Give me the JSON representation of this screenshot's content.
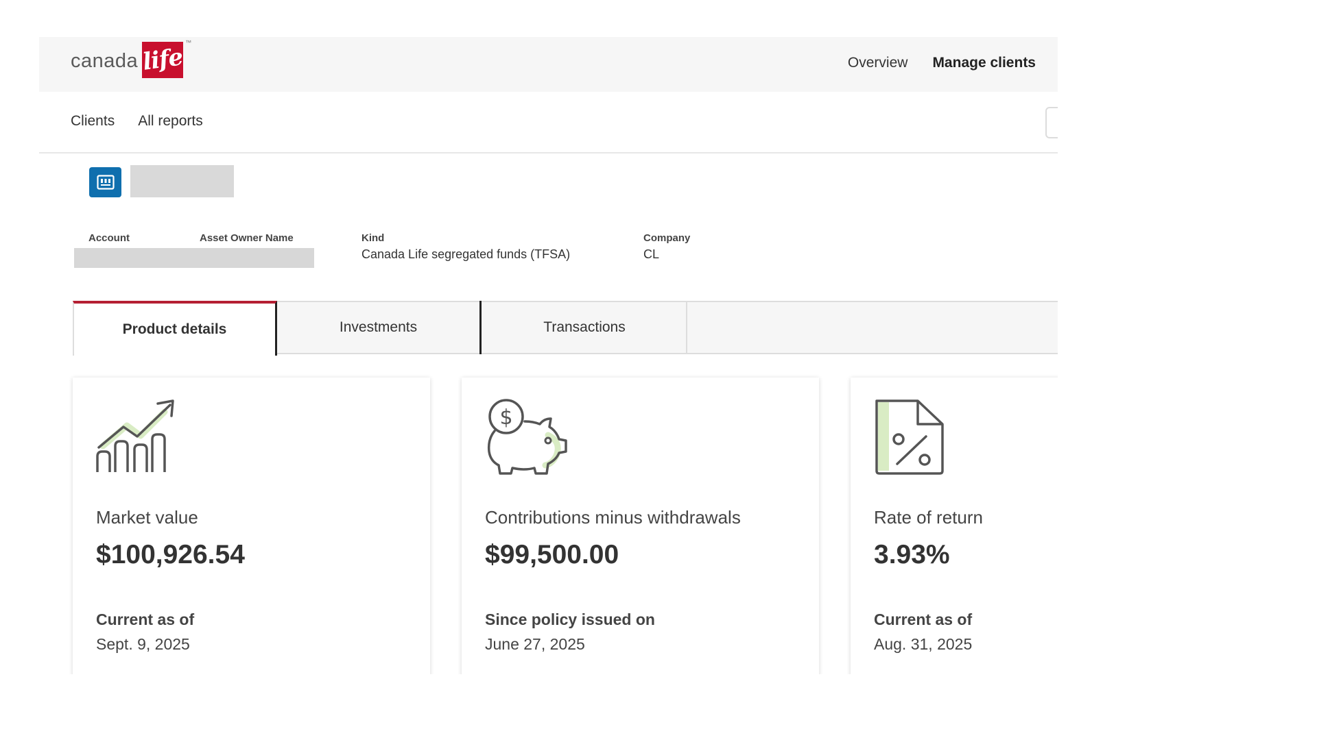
{
  "brand": {
    "wordmark": "canada",
    "script": "life",
    "trademark": "™",
    "accent_color": "#c8102e"
  },
  "top_nav": {
    "items": [
      {
        "label": "Overview",
        "active": false
      },
      {
        "label": "Manage clients",
        "active": true
      }
    ]
  },
  "sub_nav": {
    "items": [
      {
        "label": "Clients"
      },
      {
        "label": "All reports"
      }
    ]
  },
  "account_header": {
    "icon": "account-card-icon",
    "icon_color": "#0f6fae",
    "name_redacted": true
  },
  "account_info": {
    "account_label": "Account",
    "asset_owner_label": "Asset Owner Name",
    "kind_label": "Kind",
    "kind_value": "Canada Life segregated funds (TFSA)",
    "company_label": "Company",
    "company_value": "CL"
  },
  "tabs": [
    {
      "label": "Product details",
      "active": true
    },
    {
      "label": "Investments",
      "active": false
    },
    {
      "label": "Transactions",
      "active": false
    }
  ],
  "active_tab_color": "#b51f33",
  "cards": [
    {
      "icon": "growth-chart-icon",
      "title": "Market value",
      "value": "$100,926.54",
      "sub_label": "Current as of",
      "sub_value": "Sept. 9, 2025"
    },
    {
      "icon": "piggy-bank-icon",
      "title": "Contributions minus withdrawals",
      "value": "$99,500.00",
      "sub_label": "Since policy issued on",
      "sub_value": "June 27, 2025"
    },
    {
      "icon": "percent-document-icon",
      "title": "Rate of return",
      "value": "3.93%",
      "sub_label": "Current as of",
      "sub_value": "Aug. 31, 2025"
    }
  ],
  "icon_accent_color": "#d9ecc4"
}
